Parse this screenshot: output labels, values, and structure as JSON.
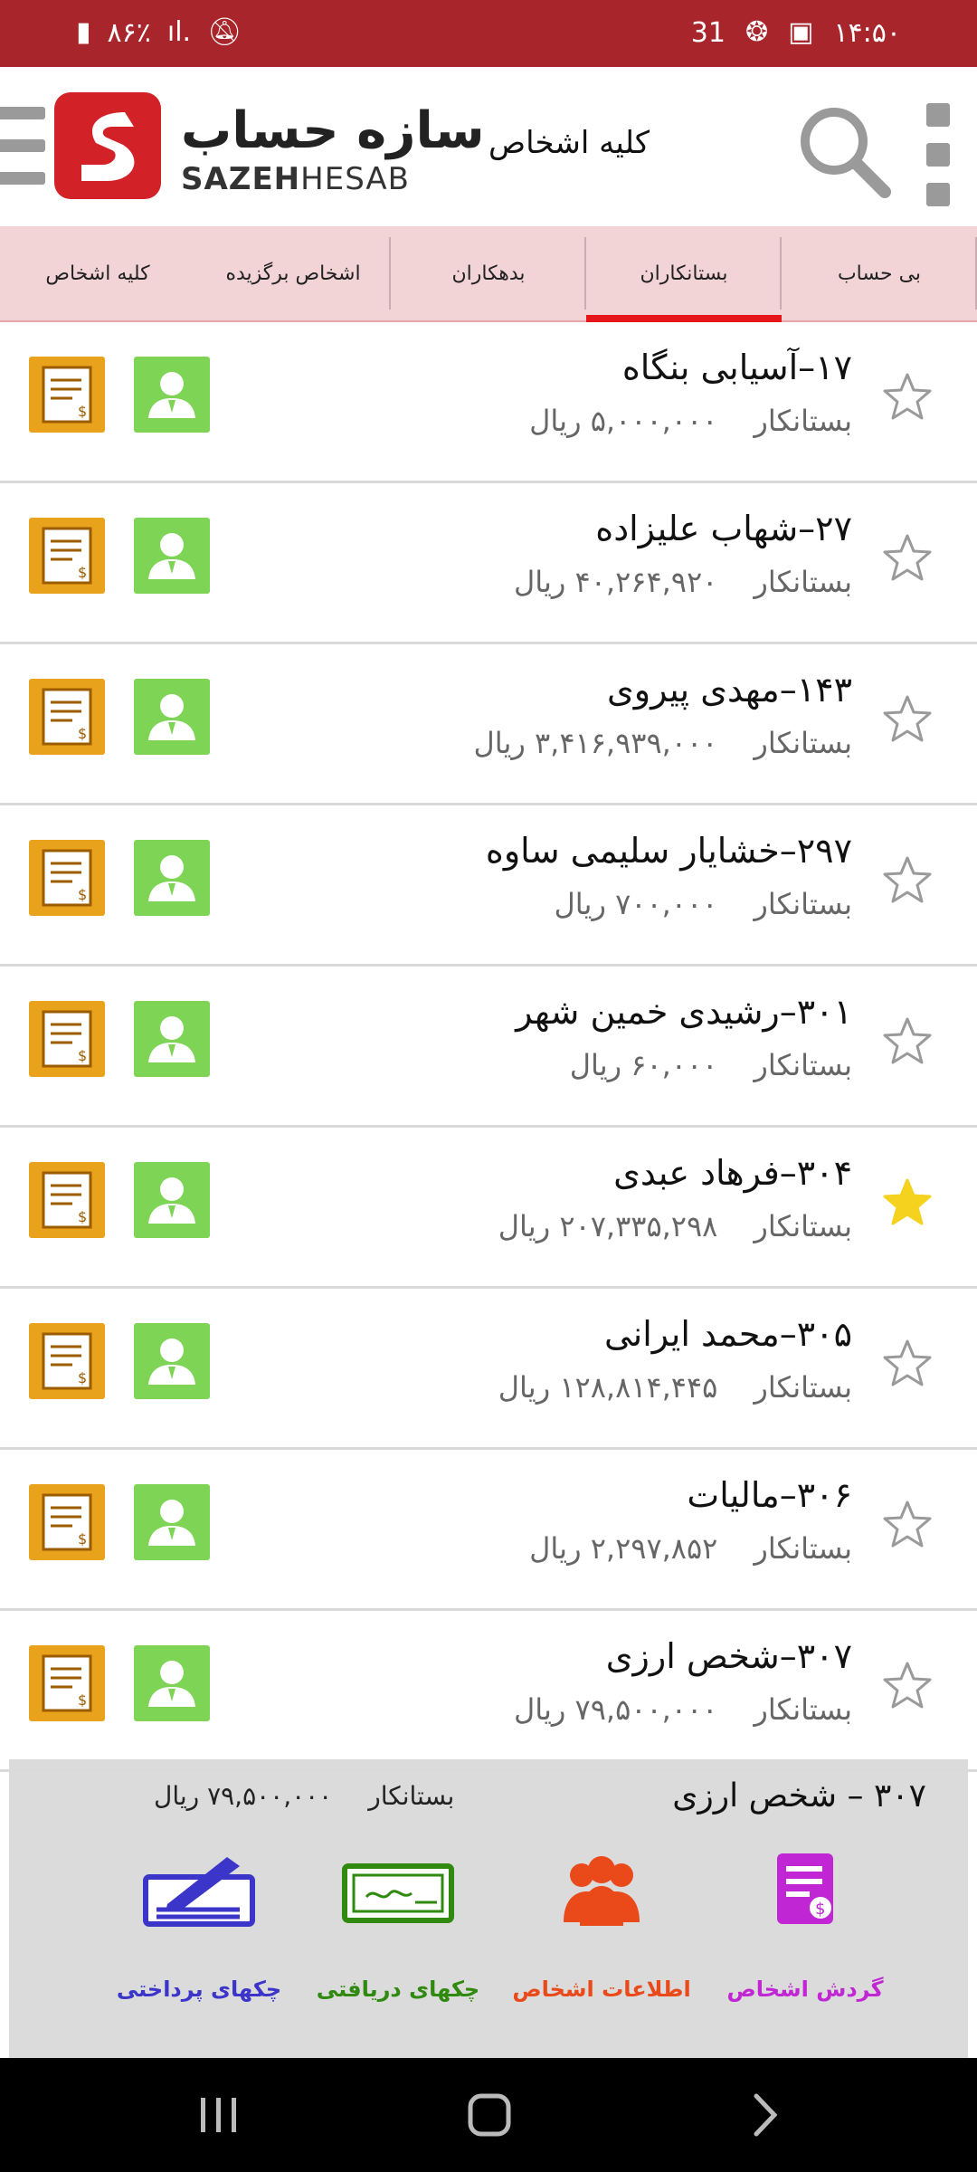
{
  "status_bar": {
    "time": "۱۴:۵۰",
    "battery": "۸۶٪",
    "notification_count": "31"
  },
  "header": {
    "logo_fa": "سازه حساب",
    "logo_en_bold": "SAZEH",
    "logo_en_light": "HESAB",
    "title": "کلیه اشخاص"
  },
  "tabs": [
    {
      "label": "بی حساب",
      "active": false
    },
    {
      "label": "بستانکاران",
      "active": true
    },
    {
      "label": "بدهکاران",
      "active": false
    },
    {
      "label": "اشخاص برگزیده",
      "active": false
    },
    {
      "label": "کلیه اشخاص",
      "active": false
    }
  ],
  "people": [
    {
      "name": "۱۷–آسیابی بنگاه",
      "status": "بستانکار",
      "amount": "۵,۰۰۰,۰۰۰  ریال",
      "favorite": false
    },
    {
      "name": "۲۷–شهاب علیزاده",
      "status": "بستانکار",
      "amount": "۴۰,۲۶۴,۹۲۰  ریال",
      "favorite": false
    },
    {
      "name": "۱۴۳–مهدی پیروی",
      "status": "بستانکار",
      "amount": "۳,۴۱۶,۹۳۹,۰۰۰  ریال",
      "favorite": false
    },
    {
      "name": "۲۹۷–خشایار سلیمی ساوه",
      "status": "بستانکار",
      "amount": "۷۰۰,۰۰۰  ریال",
      "favorite": false
    },
    {
      "name": "۳۰۱–رشیدی  خمین شهر",
      "status": "بستانکار",
      "amount": "۶۰,۰۰۰  ریال",
      "favorite": false
    },
    {
      "name": "۳۰۴–فرهاد عبدی",
      "status": "بستانکار",
      "amount": "۲۰۷,۳۳۵,۲۹۸  ریال",
      "favorite": true
    },
    {
      "name": "۳۰۵–محمد ایرانی",
      "status": "بستانکار",
      "amount": "۱۲۸,۸۱۴,۴۴۵  ریال",
      "favorite": false
    },
    {
      "name": "۳۰۶–مالیات",
      "status": "بستانکار",
      "amount": "۲,۲۹۷,۸۵۲  ریال",
      "favorite": false
    },
    {
      "name": "۳۰۷–شخص ارزی",
      "status": "بستانکار",
      "amount": "۷۹,۵۰۰,۰۰۰  ریال",
      "favorite": false
    }
  ],
  "popup": {
    "title": "۳۰۷ – شخص ارزی",
    "status": "بستانکار",
    "amount": "۷۹,۵۰۰,۰۰۰  ریال",
    "actions": [
      {
        "label": "گردش اشخاص",
        "icon": "person-turnover-icon",
        "color": "#c026d3"
      },
      {
        "label": "اطلاعات اشخاص",
        "icon": "people-info-icon",
        "color": "#ea4a1a"
      },
      {
        "label": "چکهای دریافتی",
        "icon": "received-cheque-icon",
        "color": "#2f8a0f"
      },
      {
        "label": "چکهای پرداختی",
        "icon": "paid-cheque-icon",
        "color": "#3b36c9"
      }
    ]
  },
  "colors": {
    "brand_red": "#a8262b",
    "tab_bg": "#f2d4d7",
    "tab_indicator": "#e6141b",
    "doc_button": "#e8a21b",
    "person_button": "#7dd455",
    "star_active": "#f5d21e"
  }
}
